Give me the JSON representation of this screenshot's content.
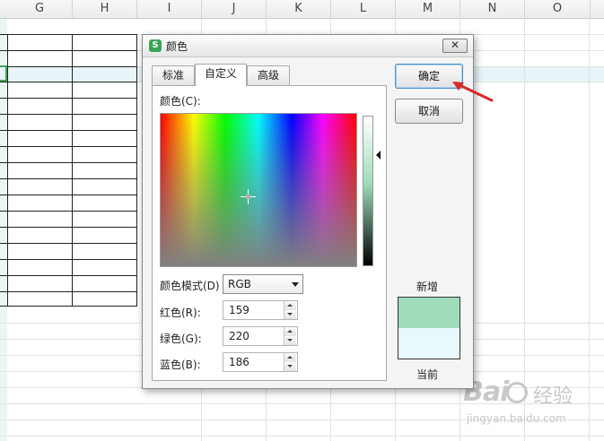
{
  "spreadsheet": {
    "columns": [
      "G",
      "H",
      "I",
      "J",
      "K",
      "L",
      "M",
      "N",
      "O"
    ]
  },
  "dialog": {
    "title": "颜色",
    "close_symbol": "✕",
    "tabs": [
      {
        "label": "标准",
        "active": false
      },
      {
        "label": "自定义",
        "active": true
      },
      {
        "label": "高级",
        "active": false
      }
    ],
    "color_label": "颜色(C):",
    "mode_label": "颜色模式(D)",
    "mode_value": "RGB",
    "red_label": "红色(R):",
    "red_value": "159",
    "green_label": "绿色(G):",
    "green_value": "220",
    "blue_label": "蓝色(B):",
    "blue_value": "186",
    "ok_button": "确定",
    "cancel_button": "取消",
    "new_label": "新增",
    "current_label": "当前",
    "new_color": "#9fdcba",
    "current_color": "#e8f8fc"
  },
  "watermark": {
    "brand": "Bai",
    "brand_cn": "经验",
    "url": "jingyan.baidu.com"
  },
  "colors": {
    "accent_green": "#3aa557",
    "annotation_arrow": "#d62a2a"
  }
}
